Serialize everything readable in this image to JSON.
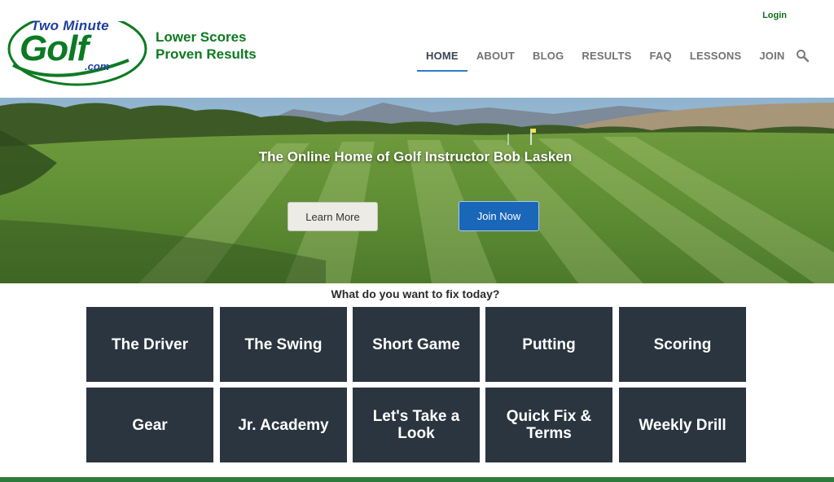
{
  "brand": {
    "logo_line1": "Two Minute",
    "logo_line2": "Golf",
    "logo_line3": ".com",
    "tagline_line1": "Lower Scores",
    "tagline_line2": "Proven Results",
    "green": "#0f7a22",
    "blue": "#1f3f9e"
  },
  "header": {
    "login_label": "Login",
    "search_icon": "magnifier-icon"
  },
  "nav": {
    "items": [
      {
        "label": "HOME",
        "active": true
      },
      {
        "label": "ABOUT",
        "active": false
      },
      {
        "label": "BLOG",
        "active": false
      },
      {
        "label": "RESULTS",
        "active": false
      },
      {
        "label": "FAQ",
        "active": false
      },
      {
        "label": "LESSONS",
        "active": false
      },
      {
        "label": "JOIN",
        "active": false
      }
    ]
  },
  "hero": {
    "title": "The Online Home of Golf Instructor Bob Lasken",
    "learn_more_label": "Learn More",
    "join_now_label": "Join Now",
    "join_color": "#1a66b8"
  },
  "fix": {
    "heading": "What do you want to fix today?",
    "tiles": [
      "The Driver",
      "The Swing",
      "Short Game",
      "Putting",
      "Scoring",
      "Gear",
      "Jr. Academy",
      "Let's Take a Look",
      "Quick Fix & Terms",
      "Weekly Drill"
    ],
    "tile_color": "#2b3540"
  }
}
